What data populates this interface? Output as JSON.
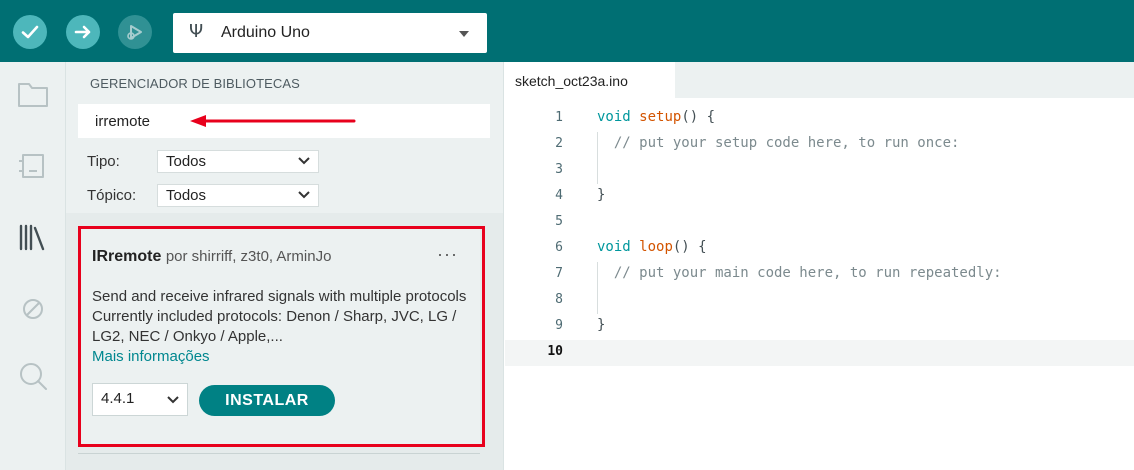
{
  "toolbar": {
    "verify_icon": "check-icon",
    "upload_icon": "arrow-right-icon",
    "debug_icon": "debug-icon",
    "board": {
      "usb_icon": "usb-icon",
      "usb_glyph": "Ψ",
      "name": "Arduino Uno",
      "dropdown_icon": "caret-down-icon"
    }
  },
  "sidebar": {
    "icons": [
      "folder-icon",
      "board-manager-icon",
      "library-icon",
      "debug-disabled-icon",
      "search-icon"
    ]
  },
  "library_manager": {
    "title": "GERENCIADOR DE BIBLIOTECAS",
    "search_value": "irremote",
    "filters": {
      "type_label": "Tipo:",
      "type_value": "Todos",
      "topic_label": "Tópico:",
      "topic_value": "Todos"
    },
    "result": {
      "name": "IRremote",
      "by_text": "por shirriff, z3t0, ArminJo",
      "more_menu": "···",
      "description": "Send and receive infrared signals with multiple protocols Currently included protocols: Denon / Sharp, JVC, LG / LG2, NEC / Onkyo / Apple,...",
      "more_info": "Mais informações",
      "version": "4.4.1",
      "install_label": "INSTALAR"
    }
  },
  "editor": {
    "tab": "sketch_oct23a.ino",
    "current_line": 10,
    "lines": [
      {
        "n": "1",
        "parts": [
          [
            "kw",
            "void "
          ],
          [
            "fn",
            "setup"
          ],
          [
            "pn",
            "() {"
          ]
        ]
      },
      {
        "n": "2",
        "parts": [
          [
            "cm",
            "  // put your setup code here, to run once:"
          ]
        ]
      },
      {
        "n": "3",
        "parts": []
      },
      {
        "n": "4",
        "parts": [
          [
            "pn",
            "}"
          ]
        ]
      },
      {
        "n": "5",
        "parts": []
      },
      {
        "n": "6",
        "parts": [
          [
            "kw",
            "void "
          ],
          [
            "fn",
            "loop"
          ],
          [
            "pn",
            "() {"
          ]
        ]
      },
      {
        "n": "7",
        "parts": [
          [
            "cm",
            "  // put your main code here, to run repeatedly:"
          ]
        ]
      },
      {
        "n": "8",
        "parts": []
      },
      {
        "n": "9",
        "parts": [
          [
            "pn",
            "}"
          ]
        ]
      },
      {
        "n": "10",
        "parts": []
      }
    ]
  },
  "colors": {
    "toolbar_bg": "#006f73",
    "accent": "#008184",
    "highlight_box": "#e8001c",
    "annotation_arrow": "#e8001c"
  }
}
